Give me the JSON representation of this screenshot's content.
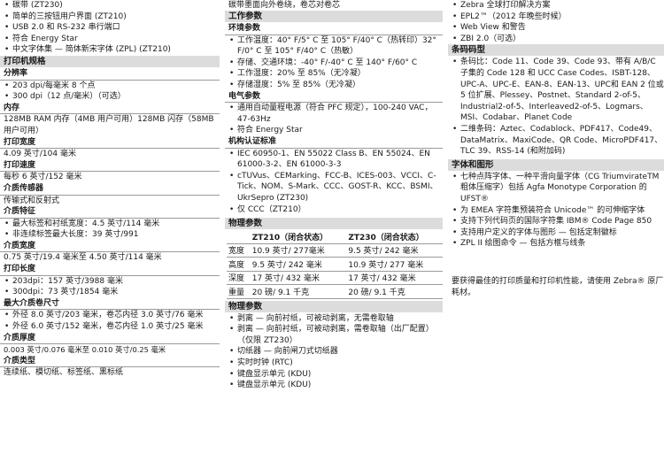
{
  "col1": {
    "top_bullets": [
      "碳带 (ZT230)",
      "简单的三按钮用户界面 (ZT210)",
      "USB 2.0 和 RS-232 串行端口",
      "符合 Energy Star",
      "中文字体集 — 简体新宋字体 (ZPL) (ZT210)"
    ],
    "header": "打印机规格",
    "resolution": {
      "title": "分辨率",
      "items": [
        "203 dpi/每毫米 8 个点",
        "300 dpi（12 点/毫米）（可选）"
      ]
    },
    "memory": {
      "title": "内存",
      "text": "128MB RAM 内存（4MB 用户可用）128MB 闪存（58MB 用户可用）"
    },
    "print_width": {
      "title": "打印宽度",
      "text": "4.09 英寸/104 毫米"
    },
    "print_speed": {
      "title": "打印速度",
      "text": "每秒 6 英寸/152 毫米"
    },
    "media_sensor": {
      "title": "介质传感器",
      "text": "传输式和反射式"
    },
    "media_features": {
      "title": "介质特征",
      "items": [
        "最大标签和衬纸宽度：4.5 英寸/114 毫米",
        "非连续标签最大长度：39 英寸/991"
      ]
    },
    "media_width": {
      "title": "介质宽度",
      "text": "0.75 英寸/19.4 毫米至 4.50 英寸/114 毫米"
    },
    "print_length": {
      "title": "打印长度",
      "items": [
        "203dpi：157 英寸/3988 毫米",
        "300dpi：73 英寸/1854 毫米"
      ]
    },
    "max_roll": {
      "title": "最大介质卷尺寸",
      "items": [
        "外径 8.0 英寸/203 毫米，卷芯内径 3.0 英寸/76 毫米",
        "外径 6.0 英寸/152 毫米，卷芯内径 1.0 英寸/25 毫米"
      ]
    },
    "media_thickness": {
      "title": "介质厚度",
      "text": "0.003 英寸/0.076 毫米至 0.010 英寸/0.25 毫米"
    },
    "media_type": {
      "title": "介质类型",
      "text": "连续纸、模切纸、标签纸、黑标纸"
    }
  },
  "col2": {
    "top_fragment": "碳带墨面向外卷绕，卷芯对卷芯",
    "operating": {
      "header": "工作参数",
      "env_title": "环境参数",
      "env_items": [
        "工作温度：40° F/5° C 至 105° F/40° C（热转印）32° F/0° C 至 105° F/40° C（热敏）",
        "存储、交通环境：-40° F/-40° C 至 140° F/60° C",
        "工作湿度：20% 至 85%（无冷凝）",
        "存储湿度：5% 至 85%（无冷凝）"
      ],
      "elec_title": "电气参数",
      "elec_items": [
        "通用自动量程电源（符合 PFC 规定），100-240 VAC，47-63Hz",
        "符合 Energy Star"
      ],
      "cert_title": "机构认证标准",
      "cert_items": [
        "IEC 60950-1、EN 55022 Class B、EN 55024、EN 61000-3-2、EN 61000-3-3",
        "cTUVus、CEMarking、FCC-B、ICES-003、VCCI、C-Tick、NOM、S-Mark、CCC、GOST-R、KCC、BSMI、UkrSepro (ZT230)",
        "仅 CCC（ZT210）"
      ]
    },
    "physical": {
      "header": "物理参数",
      "columns": [
        "",
        "ZT210（闭合状态）",
        "ZT230（闭合状态）"
      ],
      "rows": [
        [
          "宽度",
          "10.9 英寸/ 277毫米",
          "9.5 英寸/ 242 毫米"
        ],
        [
          "高度",
          "9.5 英寸/ 242 毫米",
          "10.9 英寸/ 277 毫米"
        ],
        [
          "深度",
          "17 英寸/ 432 毫米",
          "17 英寸/ 432 毫米"
        ],
        [
          "重量",
          "20 磅/ 9.1 千克",
          "20 磅/ 9.1 千克"
        ]
      ]
    },
    "options": {
      "header": "物理参数",
      "items": [
        "剥离 — 向前衬纸，可被动剥离，无需卷取轴",
        "剥离 — 向前衬纸，可被动剥离，需卷取轴（出厂配置）（仅限 ZT230）",
        "切纸器 — 向前闸刀式切纸器",
        "实时时钟 (RTC)",
        "键盘显示单元 (KDU)",
        "键盘显示单元 (KDU)"
      ]
    }
  },
  "col3": {
    "top_bullets": [
      "Zebra 全球打印解决方案",
      "EPL2™（2012 年晚些时候）",
      "Web View 和警告",
      "ZBI 2.0（可选）"
    ],
    "barcode": {
      "header": "条码码型",
      "items": [
        "条码比：Code 11、Code 39、Code 93、带有 A/B/C 子集的 Code 128 和 UCC Case Codes、ISBT-128、UPC-A、UPC-E、EAN-8、EAN-13、UPC和 EAN 2 位或 5 位扩展、Plessey、Postnet、Standard 2-of-5、Industrial2-of-5、Interleaved2-of-5、Logmars、MSI、Codabar、Planet Code",
        "二维条码：Aztec、Codablock、PDF417、Code49、DataMatrix、MaxiCode、QR Code、MicroPDF417、TLC 39、RSS-14 (和附加码)"
      ]
    },
    "fonts": {
      "header": "字体和图形",
      "items": [
        "七种点阵字体、一种平滑向量字体（CG TriumvirateTM 粗体压缩字）包括 Agfa Monotype Corporation 的 UFST®",
        "为 EMEA 字符集预装符合 Unicode™ 的可伸缩字体",
        "支持下列代码页的国际字符集 IBM® Code Page 850",
        "支持用户定义的字体与图形 — 包括定制徽标",
        "ZPL II 绘图命令 — 包括方框与线条"
      ]
    },
    "note": "要获得最佳的打印质量和打印机性能，请使用 Zebra® 原厂耗材。"
  }
}
